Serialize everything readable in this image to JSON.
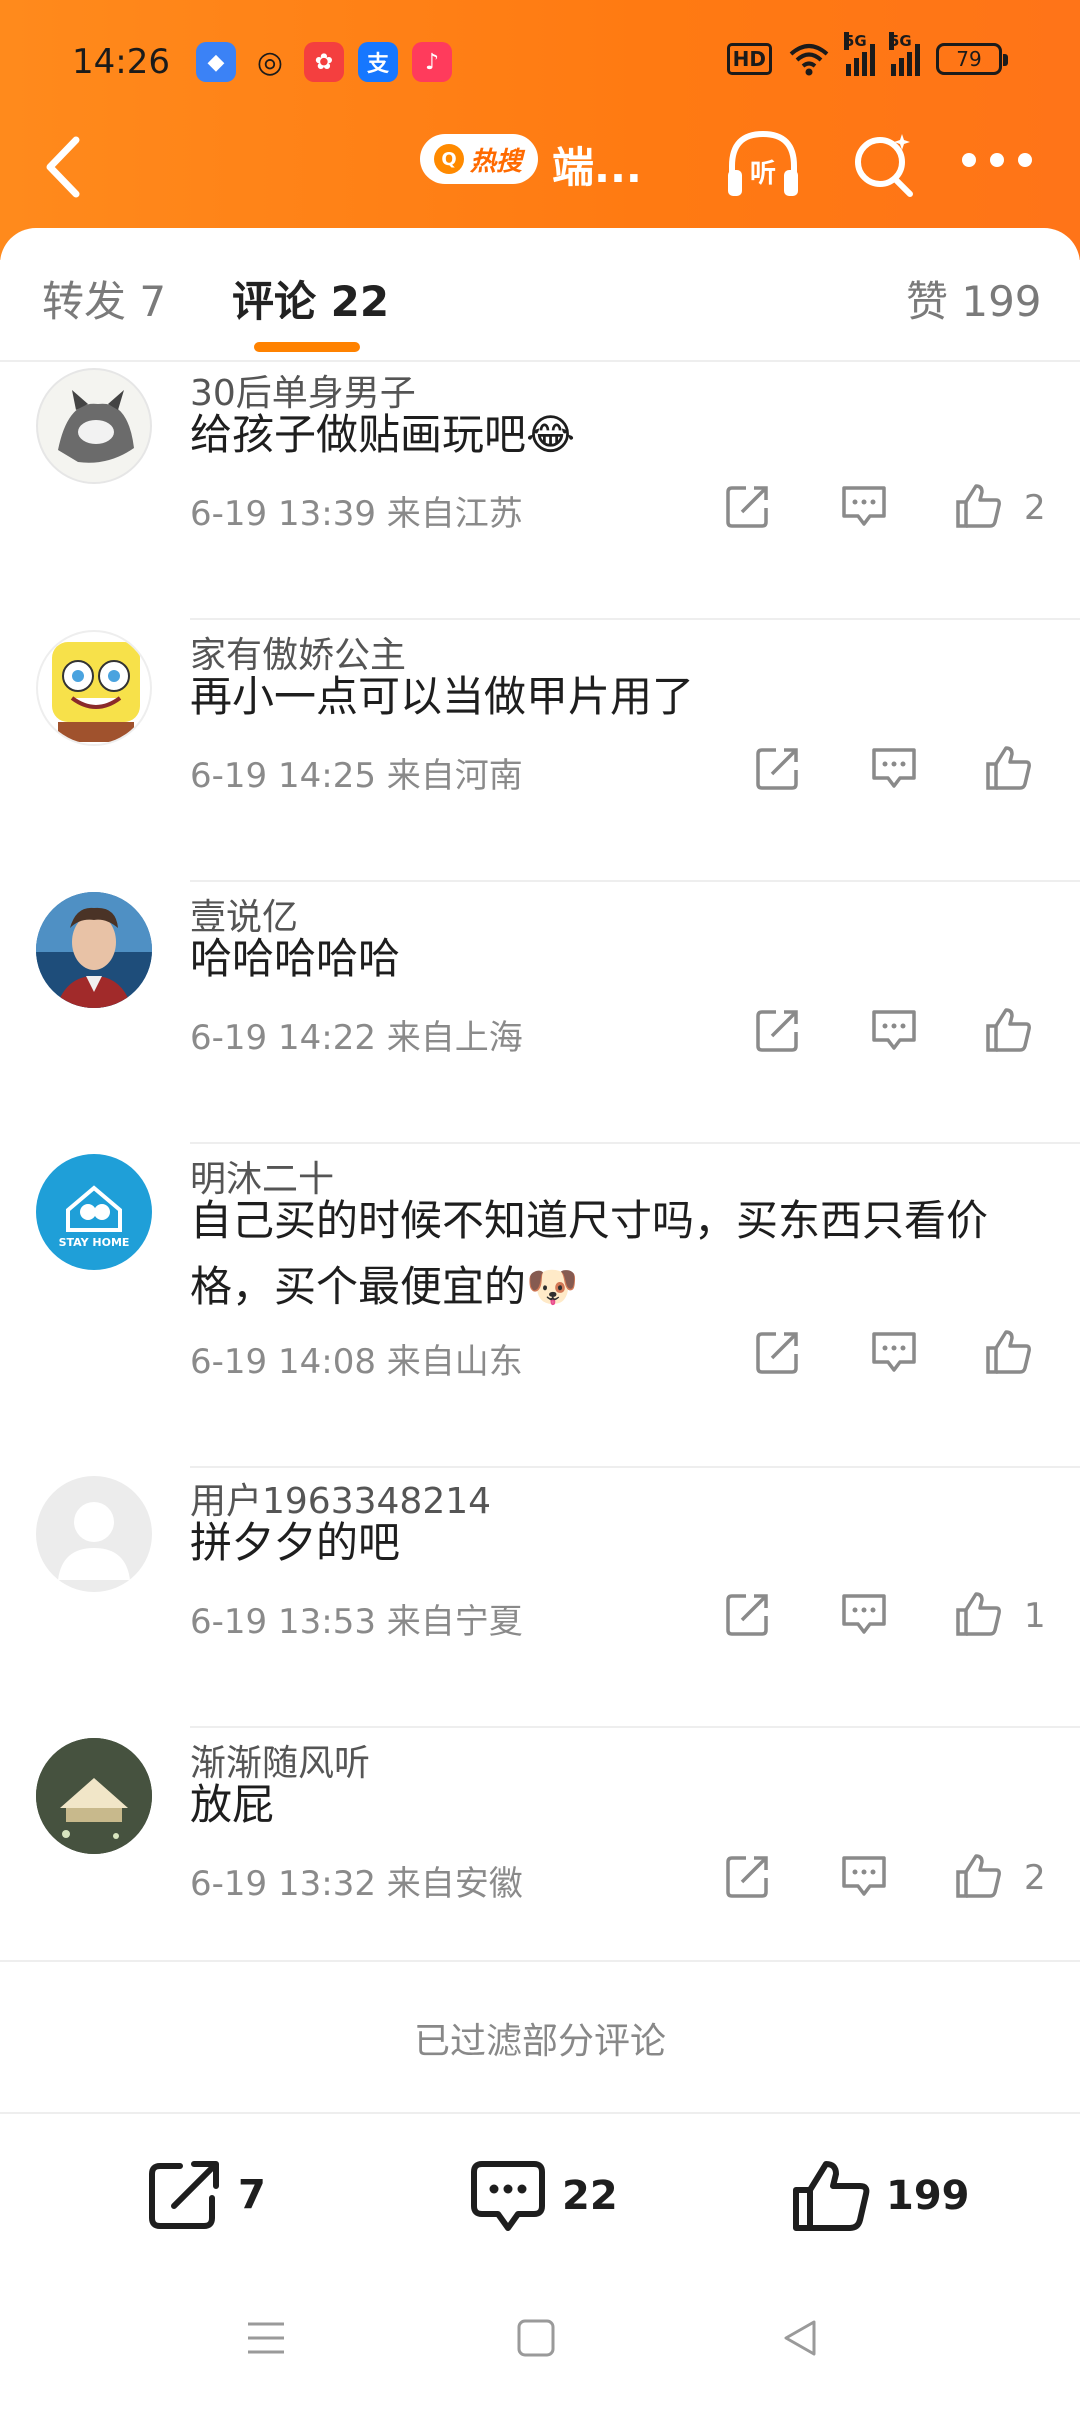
{
  "status_bar": {
    "time": "14:26",
    "hd_label": "HD",
    "signal_1_label": "5G",
    "signal_2_label": "5G",
    "battery": "79"
  },
  "navbar": {
    "hot_search_label": "热搜",
    "title": "端...",
    "listen_label": "听"
  },
  "tabs": {
    "repost": "转发 7",
    "comments": "评论 22",
    "likes": "赞 199"
  },
  "comments": [
    {
      "name": "30后单身男子",
      "text": "给孩子做贴画玩吧😂",
      "time": "6-19 13:39",
      "location": "来自江苏",
      "likes": "2"
    },
    {
      "name": "家有傲娇公主",
      "text": "再小一点可以当做甲片用了",
      "time": "6-19 14:25",
      "location": "来自河南",
      "likes": ""
    },
    {
      "name": "壹说亿",
      "text": "哈哈哈哈哈",
      "time": "6-19 14:22",
      "location": "来自上海",
      "likes": ""
    },
    {
      "name": "明沐二十",
      "text": "自己买的时候不知道尺寸吗，买东西只看价格，买个最便宜的🐶",
      "time": "6-19 14:08",
      "location": "来自山东",
      "likes": "",
      "avatar_text": "STAY HOME"
    },
    {
      "name": "用户1963348214",
      "text": "拼夕夕的吧",
      "time": "6-19 13:53",
      "location": "来自宁夏",
      "likes": "1"
    },
    {
      "name": "渐渐随风听",
      "text": "放屁",
      "time": "6-19 13:32",
      "location": "来自安徽",
      "likes": "2"
    }
  ],
  "filtered_note": "已过滤部分评论",
  "bottom_bar": {
    "repost_count": "7",
    "comment_count": "22",
    "like_count": "199"
  },
  "colors": {
    "header_orange": "#ff7a12",
    "accent": "#ff8200"
  }
}
